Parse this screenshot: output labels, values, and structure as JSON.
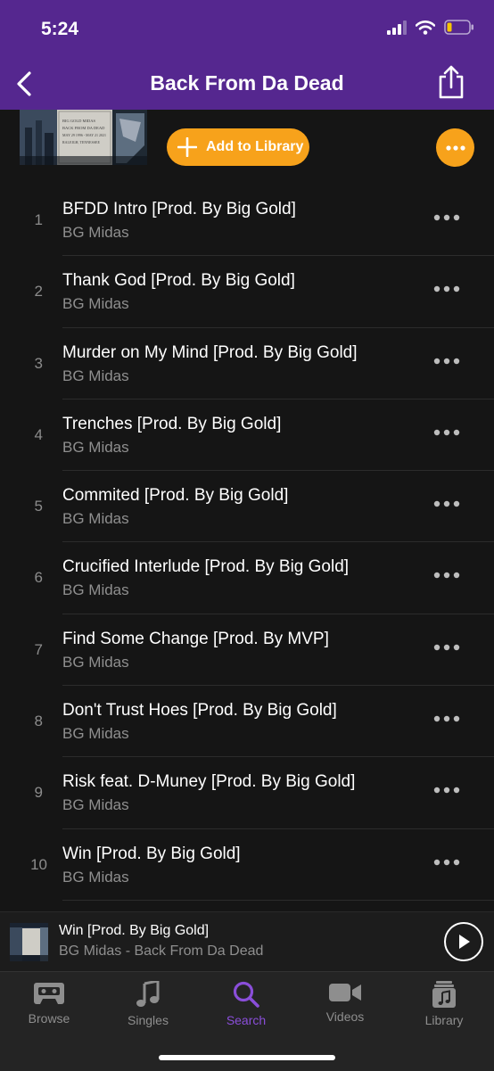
{
  "status": {
    "time": "5:24"
  },
  "header": {
    "title": "Back From Da Dead"
  },
  "album": {
    "add_label": "Add to Library",
    "art_lines": [
      "BIG GOLD MIDAS",
      "BACK FROM DA DEAD",
      "MAY 29 1996 - MAY 21 2021",
      "RALEIGH, TENNESSEE"
    ]
  },
  "tracks": [
    {
      "number": "1",
      "title": "BFDD Intro [Prod. By Big Gold]",
      "artist": "BG Midas"
    },
    {
      "number": "2",
      "title": "Thank God [Prod. By Big Gold]",
      "artist": "BG Midas"
    },
    {
      "number": "3",
      "title": "Murder on My Mind [Prod. By Big Gold]",
      "artist": "BG Midas"
    },
    {
      "number": "4",
      "title": "Trenches [Prod. By Big Gold]",
      "artist": "BG Midas"
    },
    {
      "number": "5",
      "title": "Commited [Prod. By Big Gold]",
      "artist": "BG Midas"
    },
    {
      "number": "6",
      "title": "Crucified Interlude [Prod. By Big Gold]",
      "artist": "BG Midas"
    },
    {
      "number": "7",
      "title": "Find Some Change [Prod. By MVP]",
      "artist": "BG Midas"
    },
    {
      "number": "8",
      "title": "Don't Trust Hoes [Prod. By Big Gold]",
      "artist": "BG Midas"
    },
    {
      "number": "9",
      "title": "Risk feat. D-Muney [Prod. By Big Gold]",
      "artist": "BG Midas"
    },
    {
      "number": "10",
      "title": "Win [Prod. By Big Gold]",
      "artist": "BG Midas"
    }
  ],
  "now_playing": {
    "title": "Win [Prod. By Big Gold]",
    "subtitle": "BG Midas - Back From Da Dead"
  },
  "tabs": [
    {
      "label": "Browse",
      "icon": "cassette-icon",
      "active": false
    },
    {
      "label": "Singles",
      "icon": "music-note-icon",
      "active": false
    },
    {
      "label": "Search",
      "icon": "search-icon",
      "active": true
    },
    {
      "label": "Videos",
      "icon": "video-camera-icon",
      "active": false
    },
    {
      "label": "Library",
      "icon": "library-icon",
      "active": false
    }
  ],
  "colors": {
    "header": "#55278f",
    "accent": "#f7a21b",
    "active_tab": "#8a4ed9",
    "background": "#151515"
  }
}
